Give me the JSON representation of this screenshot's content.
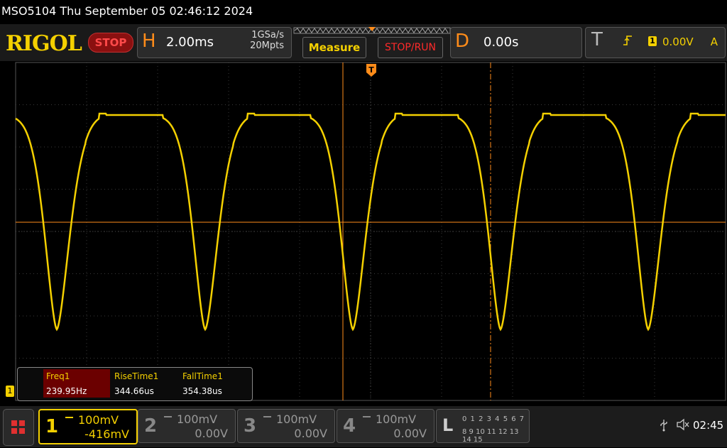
{
  "title_bar": {
    "text": "MSO5104  Thu September 05 02:46:12 2024"
  },
  "toolbar": {
    "logo": "RIGOL",
    "run_state": "STOP",
    "horizontal": {
      "letter": "H",
      "timebase": "2.00ms",
      "sample_rate": "1GSa/s",
      "memory_depth": "20Mpts"
    },
    "measure_label": "Measure",
    "stoprun_label": "STOP/RUN",
    "delay": {
      "letter": "D",
      "value": "0.00s"
    },
    "trigger": {
      "letter": "T",
      "source": "1",
      "level": "0.00V",
      "mode": "A"
    }
  },
  "measurements": {
    "headers": [
      "Freq1",
      "RiseTime1",
      "FallTime1"
    ],
    "values": [
      "239.95Hz",
      "344.66us",
      "354.38us"
    ]
  },
  "channel_marker": "1",
  "channels": [
    {
      "num": "1",
      "scale": "100mV",
      "offset": "-416mV",
      "active": true
    },
    {
      "num": "2",
      "scale": "100mV",
      "offset": "0.00V",
      "active": false
    },
    {
      "num": "3",
      "scale": "100mV",
      "offset": "0.00V",
      "active": false
    },
    {
      "num": "4",
      "scale": "100mV",
      "offset": "0.00V",
      "active": false
    }
  ],
  "logic": {
    "letter": "L",
    "row1": "0 1 2 3  4 5 6 7",
    "row2": "8 9 10 11 12 13 14 15"
  },
  "status": {
    "clock": "02:45"
  },
  "colors": {
    "ch1": "#f4d000",
    "cursor": "#ff8c1a",
    "stop": "#ff2a2a"
  },
  "icons": {
    "usb": "usb-icon",
    "speaker": "speaker-muted-icon",
    "menu": "menu-grid-icon",
    "trigger_edge": "rising-edge-icon"
  }
}
